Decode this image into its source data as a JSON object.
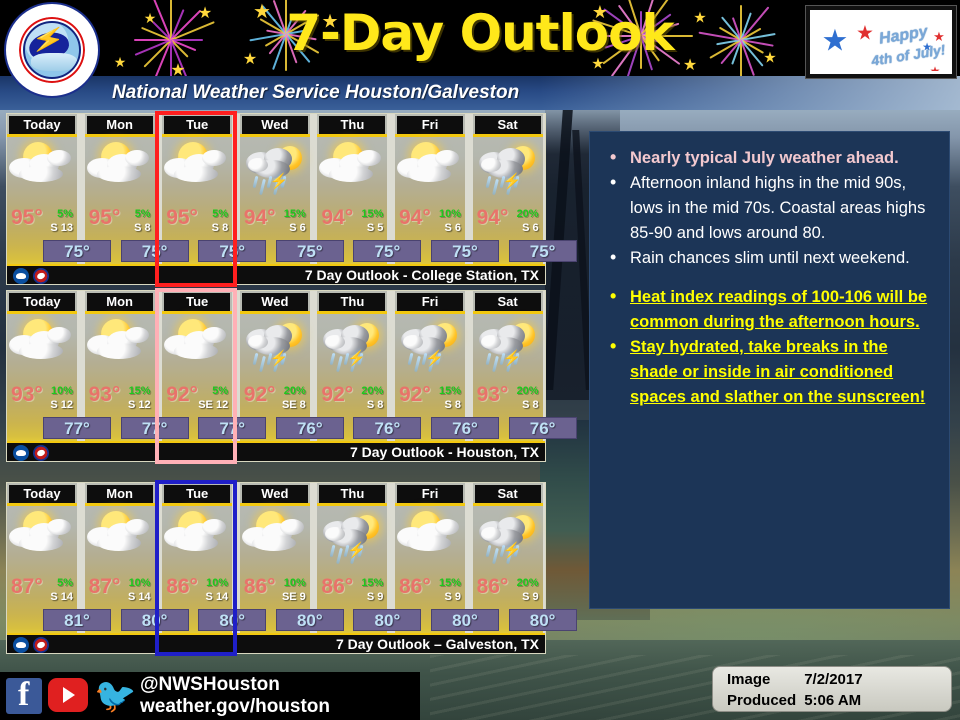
{
  "header": {
    "title": "7-Day Outlook",
    "subtitle": "National Weather Service Houston/Galveston",
    "logo_alt": "nws-seal",
    "july_line1": "Happy",
    "july_line2": "4th of July!"
  },
  "days": [
    "Today",
    "Mon",
    "Tue",
    "Wed",
    "Thu",
    "Fri",
    "Sat"
  ],
  "panels": [
    {
      "label": "7 Day Outlook - College Station, TX",
      "highlight_color": "#ff1f1f",
      "highlight_style": "red",
      "forecast": [
        {
          "day": "Today",
          "high": "95°",
          "pop": "5%",
          "wind": "S 13",
          "low": "75°",
          "icon": "sun-behind-cloud"
        },
        {
          "day": "Mon",
          "high": "95°",
          "pop": "5%",
          "wind": "S 8",
          "low": "75°",
          "icon": "sun-behind-cloud"
        },
        {
          "day": "Tue",
          "high": "95°",
          "pop": "5%",
          "wind": "S 8",
          "low": "75°",
          "icon": "sun-behind-cloud"
        },
        {
          "day": "Wed",
          "high": "94°",
          "pop": "15%",
          "wind": "S 6",
          "low": "75°",
          "icon": "storm-with-sun"
        },
        {
          "day": "Thu",
          "high": "94°",
          "pop": "15%",
          "wind": "S 5",
          "low": "75°",
          "icon": "sun-behind-cloud"
        },
        {
          "day": "Fri",
          "high": "94°",
          "pop": "10%",
          "wind": "S 6",
          "low": "75°",
          "icon": "sun-behind-cloud"
        },
        {
          "day": "Sat",
          "high": "94°",
          "pop": "20%",
          "wind": "S 6",
          "low": "75°",
          "icon": "storm-with-sun"
        }
      ]
    },
    {
      "label": "7 Day Outlook - Houston, TX",
      "highlight_color": "#ffb0b6",
      "highlight_style": "pink",
      "forecast": [
        {
          "day": "Today",
          "high": "93°",
          "pop": "10%",
          "wind": "S 12",
          "low": "77°",
          "icon": "sun-behind-cloud"
        },
        {
          "day": "Mon",
          "high": "93°",
          "pop": "15%",
          "wind": "S 12",
          "low": "77°",
          "icon": "sun-behind-cloud"
        },
        {
          "day": "Tue",
          "high": "92°",
          "pop": "5%",
          "wind": "SE 12",
          "low": "77°",
          "icon": "sun-behind-cloud"
        },
        {
          "day": "Wed",
          "high": "92°",
          "pop": "20%",
          "wind": "SE 8",
          "low": "76°",
          "icon": "storm-with-sun"
        },
        {
          "day": "Thu",
          "high": "92°",
          "pop": "20%",
          "wind": "S 8",
          "low": "76°",
          "icon": "storm-with-sun"
        },
        {
          "day": "Fri",
          "high": "92°",
          "pop": "15%",
          "wind": "S 8",
          "low": "76°",
          "icon": "storm-with-sun"
        },
        {
          "day": "Sat",
          "high": "93°",
          "pop": "20%",
          "wind": "S 8",
          "low": "76°",
          "icon": "storm-with-sun"
        }
      ]
    },
    {
      "label": "7 Day Outlook – Galveston, TX",
      "highlight_color": "#1f1fc8",
      "highlight_style": "blue",
      "forecast": [
        {
          "day": "Today",
          "high": "87°",
          "pop": "5%",
          "wind": "S 14",
          "low": "81°",
          "icon": "sun-behind-cloud"
        },
        {
          "day": "Mon",
          "high": "87°",
          "pop": "10%",
          "wind": "S 14",
          "low": "80°",
          "icon": "sun-behind-cloud"
        },
        {
          "day": "Tue",
          "high": "86°",
          "pop": "10%",
          "wind": "S 14",
          "low": "80°",
          "icon": "sun-behind-cloud"
        },
        {
          "day": "Wed",
          "high": "86°",
          "pop": "10%",
          "wind": "SE 9",
          "low": "80°",
          "icon": "sun-behind-cloud"
        },
        {
          "day": "Thu",
          "high": "86°",
          "pop": "15%",
          "wind": "S 9",
          "low": "80°",
          "icon": "storm-with-sun"
        },
        {
          "day": "Fri",
          "high": "86°",
          "pop": "15%",
          "wind": "S 9",
          "low": "80°",
          "icon": "sun-behind-cloud"
        },
        {
          "day": "Sat",
          "high": "86°",
          "pop": "20%",
          "wind": "S 9",
          "low": "80°",
          "icon": "storm-with-sun"
        }
      ]
    }
  ],
  "notes": {
    "bullets": [
      {
        "text": "Nearly typical July weather ahead.",
        "style": "pink"
      },
      {
        "text": "Afternoon inland highs in the mid 90s, lows in the mid 70s. Coastal areas highs 85-90 and lows around 80.",
        "style": "white"
      },
      {
        "text": "Rain chances slim until next weekend.",
        "style": "white"
      },
      {
        "text": "Heat index readings of 100-106 will be common during the afternoon hours.",
        "style": "yellow"
      },
      {
        "text": "Stay hydrated, take breaks in the shade or inside in air conditioned spaces and slather on the sunscreen!",
        "style": "yellow"
      }
    ]
  },
  "footer": {
    "handle": "@NWSHouston",
    "website": "weather.gov/houston",
    "facebook_icon": "facebook-icon",
    "youtube_icon": "youtube-icon",
    "twitter_icon": "twitter-icon",
    "stamp_label_line1": "Image",
    "stamp_label_line2": "Produced",
    "stamp_date": "7/2/2017",
    "stamp_time": "5:06 AM"
  },
  "colors": {
    "title_yellow": "#ffe81a",
    "band_blue": "#284a85",
    "panel_accent": "#f2c80f",
    "high_temp": "#e8736a",
    "pop_green": "#1ec81e",
    "low_box": "#6b6290",
    "notes_bg": "#1c3557",
    "alert_yellow": "#ffff00"
  }
}
